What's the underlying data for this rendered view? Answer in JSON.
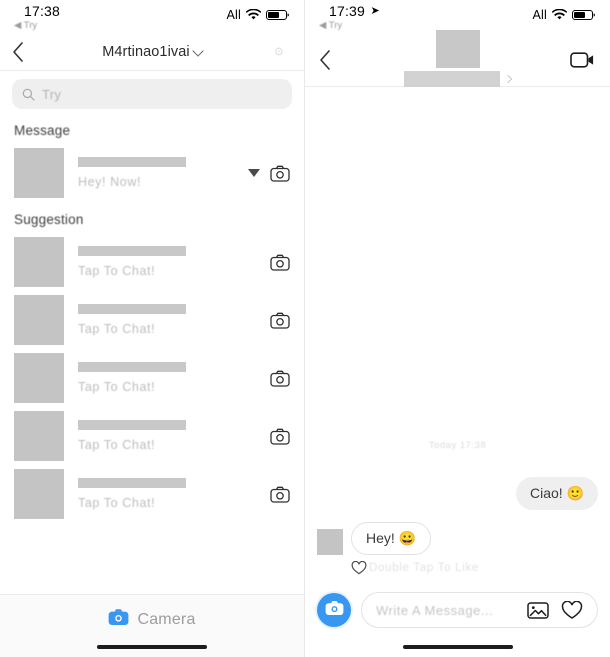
{
  "left": {
    "status": {
      "time": "17:38",
      "back_app": "◀ Try",
      "carrier": "All",
      "wifi_icon": "wifi-icon",
      "battery_icon": "battery-icon"
    },
    "nav": {
      "back_icon": "chevron-left-icon",
      "title": "M4rtinao1ivai",
      "title_chevron_icon": "chevron-down-icon",
      "right_icon": "more-options-icon"
    },
    "search": {
      "icon": "search-icon",
      "placeholder": "Try"
    },
    "sections": [
      {
        "title": "Message",
        "rows": [
          {
            "avatar": "avatar",
            "name": "",
            "subtitle": "Hey! Now!",
            "has_unread_marker": true,
            "unread_icon": "triangle-down-icon",
            "camera_icon": "camera-icon"
          }
        ]
      },
      {
        "title": "Suggestion",
        "rows": [
          {
            "avatar": "avatar",
            "name": "",
            "subtitle": "Tap To Chat!",
            "has_unread_marker": false,
            "camera_icon": "camera-icon"
          },
          {
            "avatar": "avatar",
            "name": "",
            "subtitle": "Tap To Chat!",
            "has_unread_marker": false,
            "camera_icon": "camera-icon"
          },
          {
            "avatar": "avatar",
            "name": "",
            "subtitle": "Tap To Chat!",
            "has_unread_marker": false,
            "camera_icon": "camera-icon"
          },
          {
            "avatar": "avatar",
            "name": "",
            "subtitle": "Tap To Chat!",
            "has_unread_marker": false,
            "camera_icon": "camera-icon"
          },
          {
            "avatar": "avatar",
            "name": "",
            "subtitle": "Tap To Chat!",
            "has_unread_marker": false,
            "camera_icon": "camera-icon"
          }
        ]
      }
    ],
    "bottom": {
      "camera_icon": "camera-icon",
      "camera_label": "Camera"
    }
  },
  "right": {
    "status": {
      "time": "17:39",
      "location_icon": "location-arrow-icon",
      "back_app": "◀ Try",
      "carrier": "All",
      "wifi_icon": "wifi-icon",
      "battery_icon": "battery-icon"
    },
    "nav": {
      "back_icon": "chevron-left-icon",
      "contact_avatar": "avatar",
      "contact_name": "",
      "contact_chevron_icon": "chevron-right-icon",
      "video_icon": "video-call-icon"
    },
    "conversation": {
      "daystamp": "Today 17:38",
      "messages": [
        {
          "direction": "out",
          "text": "Ciao! 🙂"
        },
        {
          "direction": "in",
          "text": "Hey! 😀",
          "avatar": "avatar"
        }
      ],
      "like_hint": {
        "heart_icon": "heart-outline-icon",
        "label": "Double Tap To Like"
      }
    },
    "composer": {
      "camera_icon": "camera-icon",
      "placeholder": "Write A Message...",
      "gallery_icon": "image-icon",
      "heart_icon": "heart-outline-icon"
    }
  },
  "colors": {
    "accent_blue": "#3897f0",
    "bubble_gray": "#efeff0",
    "redact_gray": "#c4c4c4"
  }
}
